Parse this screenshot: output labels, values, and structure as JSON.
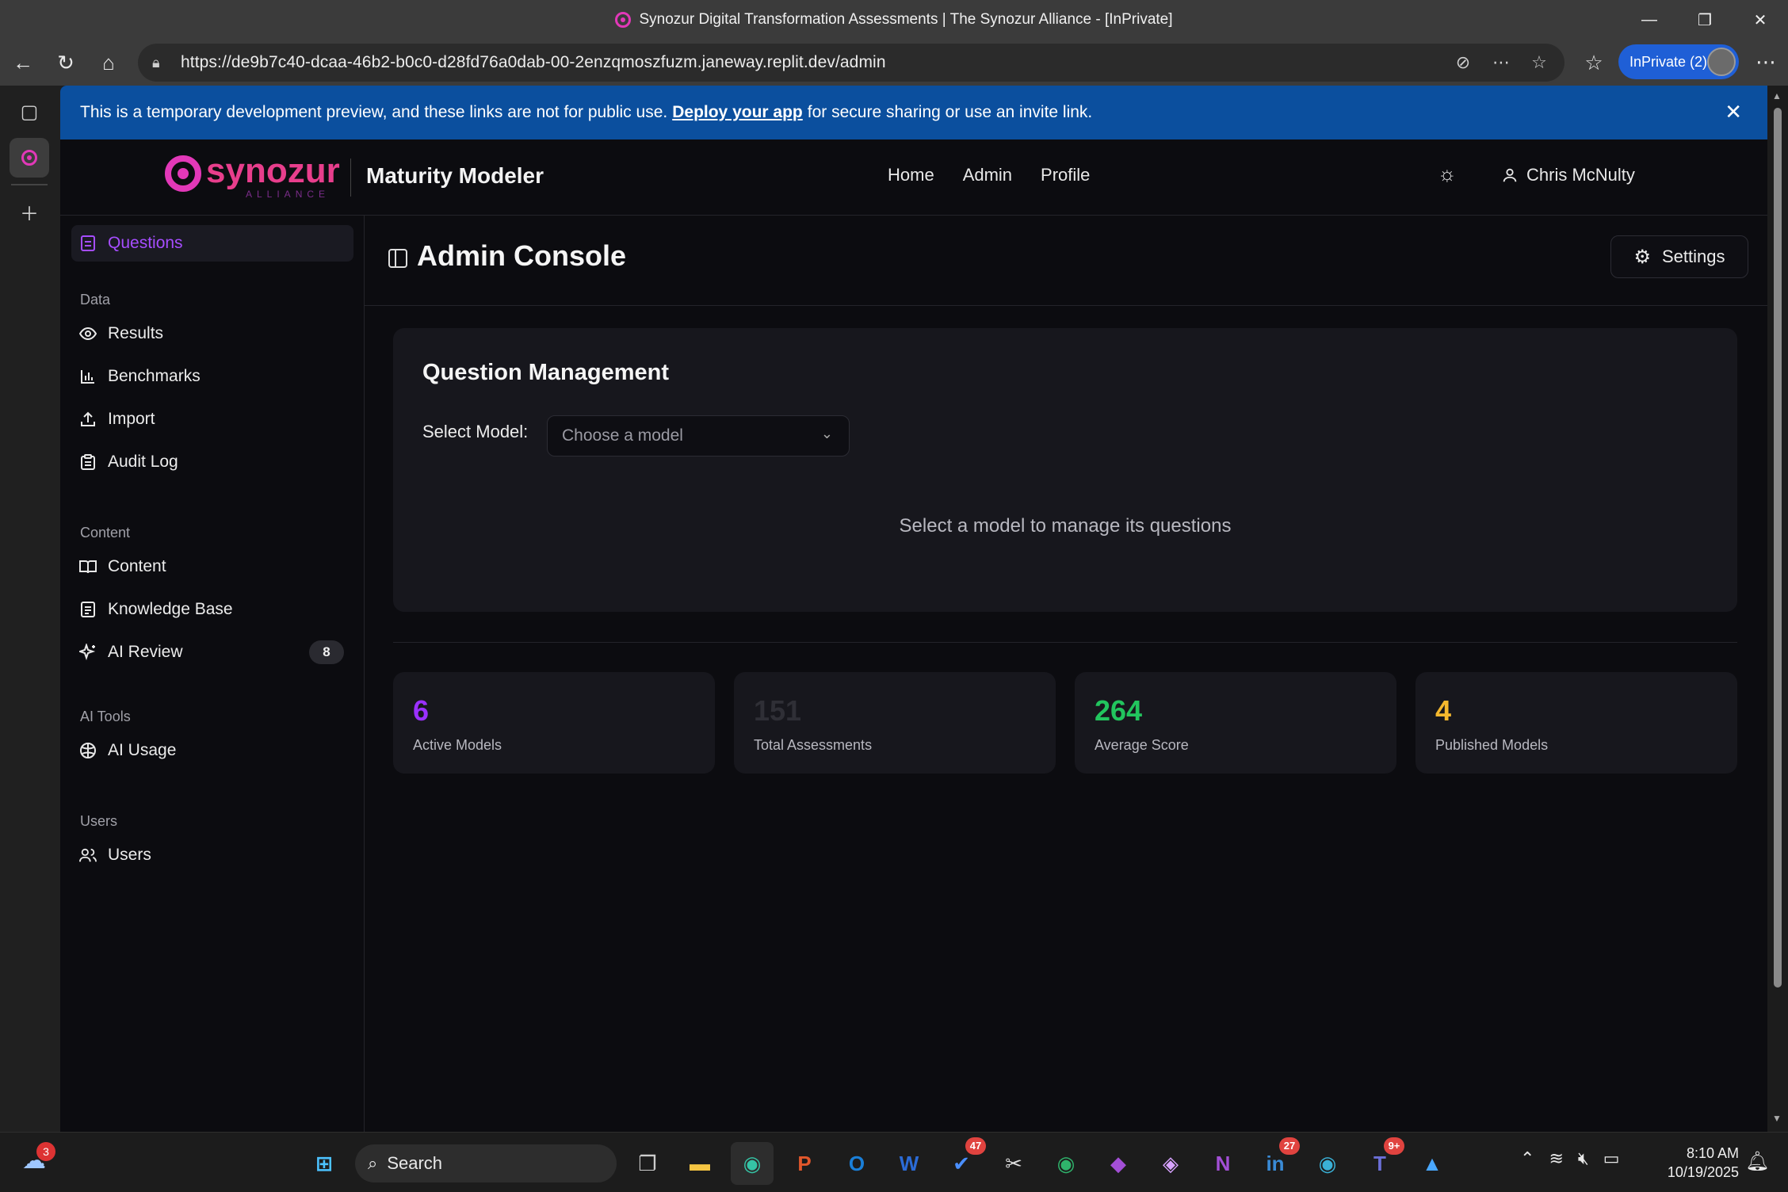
{
  "window": {
    "title": "Synozur Digital Transformation Assessments | The Synozur Alliance - [InPrivate]",
    "controls": [
      "—",
      "❐",
      "✕"
    ]
  },
  "browser": {
    "url": "https://de9b7c40-dcaa-46b2-b0c0-d28fd76a0dab-00-2enzqmoszfuzm.janeway.replit.dev/admin",
    "inprivate_label": "InPrivate (2)"
  },
  "banner": {
    "text_before": "This is a temporary development preview, and these links are not for public use.",
    "link": "Deploy your app",
    "text_after": "for secure sharing or use an invite link."
  },
  "header": {
    "logo_word": "synozur",
    "logo_sub": "ALLIANCE",
    "app_name": "Maturity Modeler",
    "nav": [
      "Home",
      "Admin",
      "Profile"
    ],
    "user_name": "Chris McNulty"
  },
  "sidebar": {
    "active_item": "Questions",
    "groups": [
      {
        "label": "Data",
        "items": [
          "Results",
          "Benchmarks",
          "Import",
          "Audit Log"
        ]
      },
      {
        "label": "Content",
        "items": [
          "Content",
          "Knowledge Base",
          "AI Review"
        ]
      },
      {
        "label": "AI Tools",
        "items": [
          "AI Usage"
        ]
      },
      {
        "label": "Users",
        "items": [
          "Users"
        ]
      }
    ],
    "ai_review_badge": "8"
  },
  "main": {
    "title": "Admin Console",
    "settings_label": "Settings",
    "question_mgmt": {
      "title": "Question Management",
      "select_label": "Select Model:",
      "select_placeholder": "Choose a model",
      "empty_message": "Select a model to manage its questions"
    },
    "stats": [
      {
        "value": "6",
        "label": "Active Models",
        "color": "#9b30ff"
      },
      {
        "value": "151",
        "label": "Total Assessments",
        "color": "#2f2f36"
      },
      {
        "value": "264",
        "label": "Average Score",
        "color": "#22c55e"
      },
      {
        "value": "4",
        "label": "Published Models",
        "color": "#f5b82e"
      }
    ]
  },
  "taskbar": {
    "weather_badge": "3",
    "search_label": "Search",
    "badges": {
      "todo": "47",
      "linkedin": "27",
      "teams": "9+"
    },
    "time": "8:10 AM",
    "date": "10/19/2025"
  }
}
